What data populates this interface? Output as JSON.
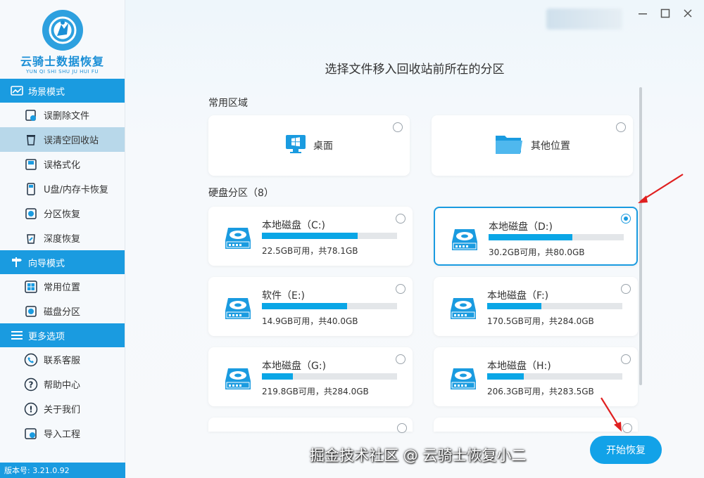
{
  "app": {
    "title": "云骑士数据恢复",
    "subtitle": "YUN QI SHI SHU JU HUI FU",
    "version": "版本号: 3.21.0.92",
    "accent": "#1a9be0"
  },
  "sidebar": {
    "sections": [
      {
        "title": "场景模式",
        "icon": "scene-icon",
        "items": [
          {
            "label": "误删除文件",
            "icon": "deleted-file-icon",
            "active": false
          },
          {
            "label": "误清空回收站",
            "icon": "recycle-bin-icon",
            "active": true
          },
          {
            "label": "误格式化",
            "icon": "format-icon",
            "active": false
          },
          {
            "label": "U盘/内存卡恢复",
            "icon": "usb-card-icon",
            "active": false
          },
          {
            "label": "分区恢复",
            "icon": "partition-icon",
            "active": false
          },
          {
            "label": "深度恢复",
            "icon": "deep-recover-icon",
            "active": false
          }
        ]
      },
      {
        "title": "向导模式",
        "icon": "signpost-icon",
        "items": [
          {
            "label": "常用位置",
            "icon": "windows-icon",
            "active": false
          },
          {
            "label": "磁盘分区",
            "icon": "disk-icon",
            "active": false
          }
        ]
      },
      {
        "title": "更多选项",
        "icon": "menu-icon",
        "items": [
          {
            "label": "联系客服",
            "icon": "phone-icon",
            "active": false
          },
          {
            "label": "帮助中心",
            "icon": "question-icon",
            "active": false
          },
          {
            "label": "关于我们",
            "icon": "info-icon",
            "active": false
          },
          {
            "label": "导入工程",
            "icon": "import-icon",
            "active": false
          }
        ]
      }
    ]
  },
  "main": {
    "title": "选择文件移入回收站前所在的分区",
    "common_label": "常用区域",
    "common": [
      {
        "label": "桌面",
        "icon": "desktop-icon",
        "selected": false
      },
      {
        "label": "其他位置",
        "icon": "folder-icon",
        "selected": false
      }
    ],
    "disks_label": "硬盘分区（8）",
    "disks": [
      {
        "name": "本地磁盘（C:)",
        "size": "22.5GB可用，共78.1GB",
        "used": 0.71,
        "selected": false
      },
      {
        "name": "本地磁盘（D:)",
        "size": "30.2GB可用，共80.0GB",
        "used": 0.62,
        "selected": true
      },
      {
        "name": "软件（E:)",
        "size": "14.9GB可用，共40.0GB",
        "used": 0.63,
        "selected": false
      },
      {
        "name": "本地磁盘（F:)",
        "size": "170.5GB可用，共284.0GB",
        "used": 0.4,
        "selected": false
      },
      {
        "name": "本地磁盘（G:)",
        "size": "219.8GB可用，共284.0GB",
        "used": 0.23,
        "selected": false
      },
      {
        "name": "本地磁盘（H:)",
        "size": "206.3GB可用，共283.5GB",
        "used": 0.27,
        "selected": false
      }
    ],
    "next_button": "开始恢复"
  },
  "watermark": "掘金技术社区 @ 云骑士恢复小二"
}
